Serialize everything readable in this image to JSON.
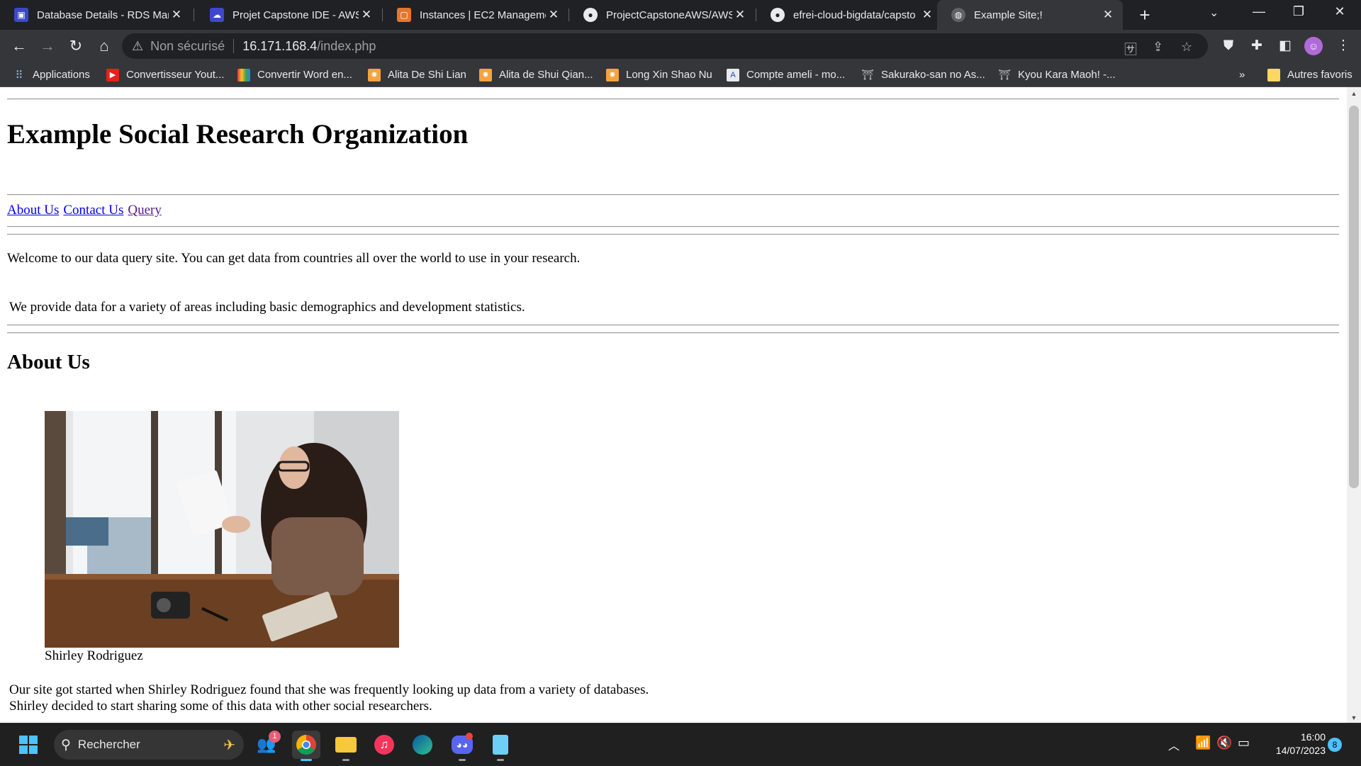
{
  "tabs": [
    {
      "title": "Database Details - RDS Mar",
      "icon": "rds-icon",
      "color": "#3b48cc"
    },
    {
      "title": "Projet Capstone IDE - AWS",
      "icon": "cloud9-icon",
      "color": "#3f48cc"
    },
    {
      "title": "Instances | EC2 Managemer",
      "icon": "ec2-icon",
      "color": "#e7762b"
    },
    {
      "title": "ProjectCapstoneAWS/AWSL",
      "icon": "github-icon",
      "color": "#202124"
    },
    {
      "title": "efrei-cloud-bigdata/capsto",
      "icon": "github-icon",
      "color": "#202124"
    },
    {
      "title": "Example Site;!",
      "icon": "globe-icon",
      "color": "#5f6368"
    }
  ],
  "omnibox": {
    "security": "Non sécurisé",
    "host": "16.171.168.4",
    "path": "/index.php"
  },
  "bookmarks": [
    {
      "label": "Applications"
    },
    {
      "label": "Convertisseur Yout..."
    },
    {
      "label": "Convertir Word en..."
    },
    {
      "label": "Alita De Shi Lian"
    },
    {
      "label": "Alita de Shui Qian..."
    },
    {
      "label": "Long Xin Shao Nu"
    },
    {
      "label": "Compte ameli - mo..."
    },
    {
      "label": "Sakurako-san no As..."
    },
    {
      "label": "Kyou Kara Maoh! -..."
    }
  ],
  "bookmarks_overflow": "»",
  "other_bookmarks": "Autres favoris",
  "page": {
    "title": "Example Social Research Organization",
    "nav": {
      "about": "About Us",
      "contact": "Contact Us",
      "query": "Query"
    },
    "welcome": "Welcome to our data query site. You can get data from countries all over the world to use in your research.",
    "provide": "We provide data for a variety of areas including basic demographics and development statistics.",
    "about_heading": "About Us",
    "caption": "Shirley Rodriguez",
    "story_line1": "Our site got started when Shirley Rodriguez found that she was frequently looking up data from a variety of databases.",
    "story_line2": "Shirley decided to start sharing some of this data with other social researchers."
  },
  "taskbar": {
    "search_label": "Rechercher",
    "people_badge": "1",
    "time": "16:00",
    "date": "14/07/2023",
    "notifications": "8"
  }
}
